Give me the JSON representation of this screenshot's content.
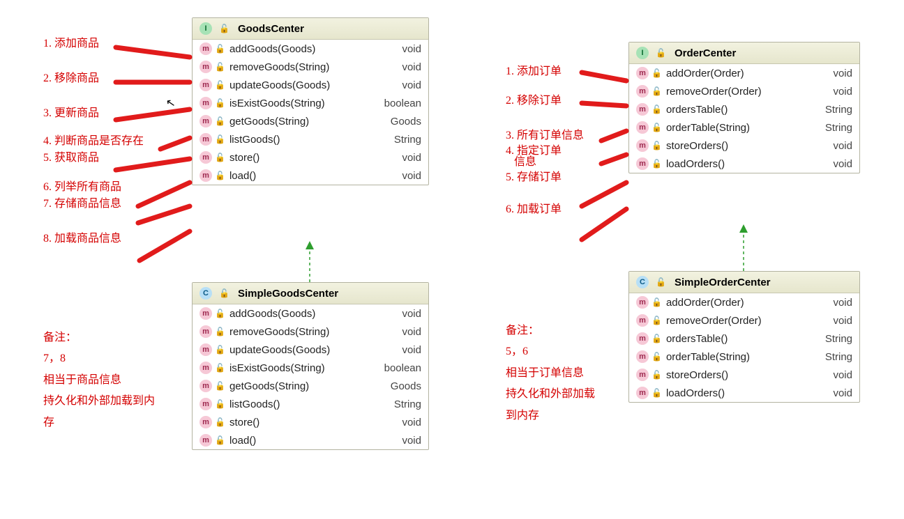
{
  "classes": {
    "goodsCenter": {
      "name": "GoodsCenter",
      "badge": "I",
      "methods": [
        {
          "sig": "addGoods(Goods)",
          "ret": "void"
        },
        {
          "sig": "removeGoods(String)",
          "ret": "void"
        },
        {
          "sig": "updateGoods(Goods)",
          "ret": "void"
        },
        {
          "sig": "isExistGoods(String)",
          "ret": "boolean"
        },
        {
          "sig": "getGoods(String)",
          "ret": "Goods"
        },
        {
          "sig": "listGoods()",
          "ret": "String"
        },
        {
          "sig": "store()",
          "ret": "void"
        },
        {
          "sig": "load()",
          "ret": "void"
        }
      ]
    },
    "simpleGoodsCenter": {
      "name": "SimpleGoodsCenter",
      "badge": "C",
      "methods": [
        {
          "sig": "addGoods(Goods)",
          "ret": "void"
        },
        {
          "sig": "removeGoods(String)",
          "ret": "void"
        },
        {
          "sig": "updateGoods(Goods)",
          "ret": "void"
        },
        {
          "sig": "isExistGoods(String)",
          "ret": "boolean"
        },
        {
          "sig": "getGoods(String)",
          "ret": "Goods"
        },
        {
          "sig": "listGoods()",
          "ret": "String"
        },
        {
          "sig": "store()",
          "ret": "void"
        },
        {
          "sig": "load()",
          "ret": "void"
        }
      ]
    },
    "orderCenter": {
      "name": "OrderCenter",
      "badge": "I",
      "methods": [
        {
          "sig": "addOrder(Order)",
          "ret": "void"
        },
        {
          "sig": "removeOrder(Order)",
          "ret": "void"
        },
        {
          "sig": "ordersTable()",
          "ret": "String"
        },
        {
          "sig": "orderTable(String)",
          "ret": "String"
        },
        {
          "sig": "storeOrders()",
          "ret": "void"
        },
        {
          "sig": "loadOrders()",
          "ret": "void"
        }
      ]
    },
    "simpleOrderCenter": {
      "name": "SimpleOrderCenter",
      "badge": "C",
      "methods": [
        {
          "sig": "addOrder(Order)",
          "ret": "void"
        },
        {
          "sig": "removeOrder(Order)",
          "ret": "void"
        },
        {
          "sig": "ordersTable()",
          "ret": "String"
        },
        {
          "sig": "orderTable(String)",
          "ret": "String"
        },
        {
          "sig": "storeOrders()",
          "ret": "void"
        },
        {
          "sig": "loadOrders()",
          "ret": "void"
        }
      ]
    }
  },
  "annotations": {
    "left": [
      "1. 添加商品",
      "2. 移除商品",
      "3. 更新商品",
      "4. 判断商品是否存在",
      "5. 获取商品",
      "6. 列举所有商品",
      "7. 存储商品信息",
      "8. 加载商品信息"
    ],
    "right": [
      "1. 添加订单",
      "2. 移除订单",
      "3. 所有订单信息",
      "4. 指定订单\n   信息",
      "5. 存储订单",
      "6. 加载订单"
    ],
    "leftNote": "备注：\n7，8\n相当于商品信息\n持久化和外部加载到内\n存",
    "rightNote": "备注：\n5，6\n相当于订单信息\n持久化和外部加载\n到内存"
  }
}
